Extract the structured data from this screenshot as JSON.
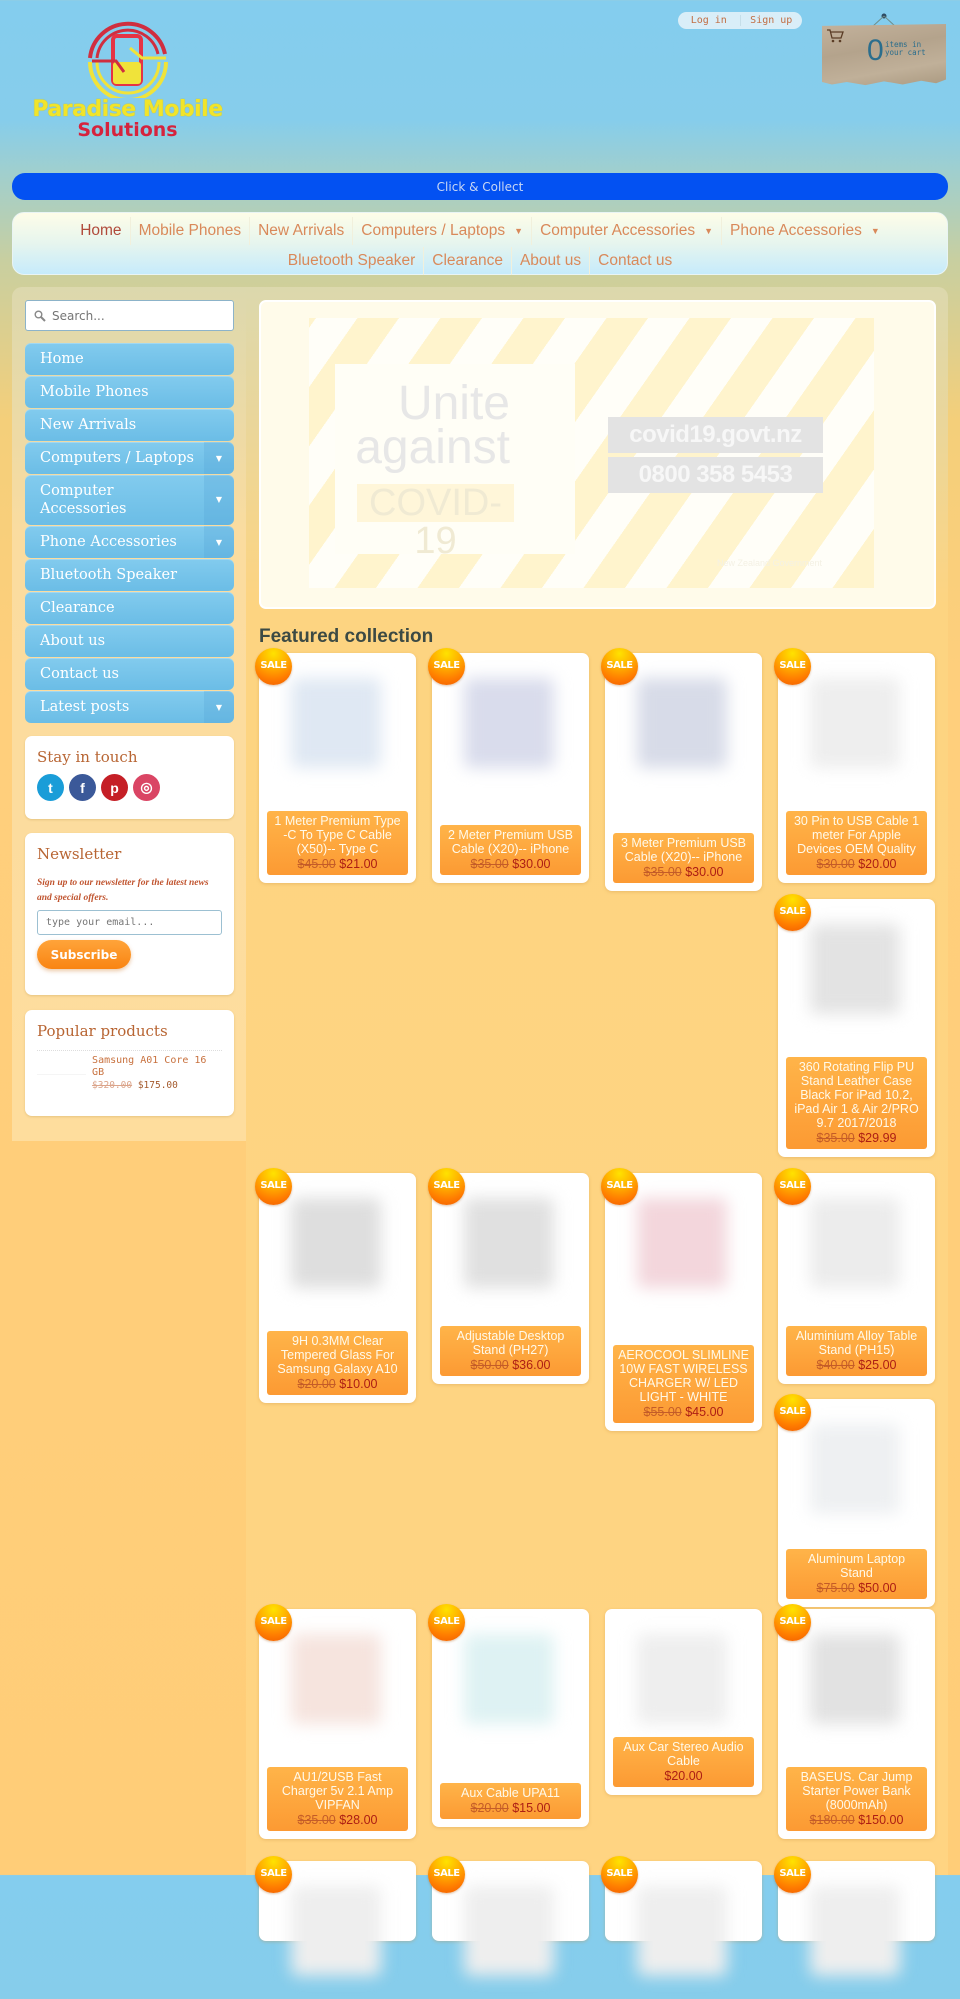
{
  "brand": {
    "line1": "Paradise Mobile",
    "line2": "Solutions",
    "colors": {
      "yellow": "#f1e42a",
      "red": "#d6233d"
    }
  },
  "auth": {
    "login": "Log in",
    "signup": "Sign up"
  },
  "cart": {
    "icon": "cart-icon",
    "count": "0",
    "label": "items in your cart"
  },
  "announcement": {
    "text": "Click & Collect",
    "color": "#0351f2"
  },
  "top_nav": {
    "items": [
      {
        "label": "Home",
        "active": true,
        "dropdown": false
      },
      {
        "label": "Mobile Phones",
        "dropdown": false
      },
      {
        "label": "New Arrivals",
        "dropdown": false
      },
      {
        "label": "Computers / Laptops",
        "dropdown": true
      },
      {
        "label": "Computer Accessories",
        "dropdown": true
      },
      {
        "label": "Phone Accessories",
        "dropdown": true
      },
      {
        "label": "Bluetooth Speaker",
        "dropdown": false
      },
      {
        "label": "Clearance",
        "dropdown": false
      },
      {
        "label": "About us",
        "dropdown": false
      },
      {
        "label": "Contact us",
        "dropdown": false
      }
    ],
    "caret": "▼"
  },
  "sidebar": {
    "search": {
      "placeholder": "Search...",
      "icon": "search-icon"
    },
    "menu": [
      {
        "label": "Home",
        "expandable": false
      },
      {
        "label": "Mobile Phones",
        "expandable": false
      },
      {
        "label": "New Arrivals",
        "expandable": false
      },
      {
        "label": "Computers / Laptops",
        "expandable": true
      },
      {
        "label": "Computer Accessories",
        "expandable": true
      },
      {
        "label": "Phone Accessories",
        "expandable": true
      },
      {
        "label": "Bluetooth Speaker",
        "expandable": false
      },
      {
        "label": "Clearance",
        "expandable": false
      },
      {
        "label": "About us",
        "expandable": false
      },
      {
        "label": "Contact us",
        "expandable": false
      },
      {
        "label": "Latest posts",
        "expandable": true
      }
    ],
    "stay_in_touch": {
      "title": "Stay in touch",
      "networks": [
        {
          "name": "twitter",
          "glyph": "t",
          "color": "#1a9dd8"
        },
        {
          "name": "facebook",
          "glyph": "f",
          "color": "#3b5999"
        },
        {
          "name": "pinterest",
          "glyph": "p",
          "color": "#c51f26"
        },
        {
          "name": "instagram",
          "glyph": "◎",
          "color": "#da4564"
        }
      ]
    },
    "newsletter": {
      "title": "Newsletter",
      "description": "Sign up to our newsletter for the latest news and special offers.",
      "placeholder": "type your email...",
      "button": "Subscribe"
    },
    "popular": {
      "title": "Popular products",
      "items": [
        {
          "name": "Samsung A01 Core 16 GB",
          "compare_price": "$320.00",
          "price": "$175.00"
        }
      ]
    }
  },
  "hero": {
    "headline_1": "Unite",
    "headline_2": "against",
    "headline_3": "COVID-19",
    "website": "covid19.govt.nz",
    "phone": "0800 358 5453",
    "footer": "New Zealand Government"
  },
  "featured": {
    "title": "Featured collection",
    "sale_label": "SALE",
    "products": [
      {
        "name": "1 Meter Premium Type -C To Type C Cable (X50)-- Type C",
        "compare_price": "$45.00",
        "price": "$21.00",
        "sale": true
      },
      {
        "name": "2 Meter Premium USB Cable (X20)-- iPhone",
        "compare_price": "$35.00",
        "price": "$30.00",
        "sale": true
      },
      {
        "name": "3 Meter Premium USB Cable (X20)-- iPhone",
        "compare_price": "$35.00",
        "price": "$30.00",
        "sale": true
      },
      {
        "name": "30 Pin to USB Cable 1 meter For Apple Devices OEM Quality",
        "compare_price": "$30.00",
        "price": "$20.00",
        "sale": true
      },
      {
        "name": "360 Rotating Flip PU Stand Leather Case Black For iPad 10.2, iPad Air 1 & Air 2/PRO 9.7 2017/2018",
        "compare_price": "$35.00",
        "price": "$29.99",
        "sale": true
      },
      {
        "name": "9H 0.3MM Clear Tempered Glass For Samsung Galaxy A10",
        "compare_price": "$20.00",
        "price": "$10.00",
        "sale": true
      },
      {
        "name": "Adjustable Desktop Stand (PH27)",
        "compare_price": "$50.00",
        "price": "$36.00",
        "sale": true
      },
      {
        "name": "AEROCOOL SLIMLINE 10W FAST WIRELESS CHARGER W/ LED LIGHT - WHITE",
        "compare_price": "$55.00",
        "price": "$45.00",
        "sale": true
      },
      {
        "name": "Aluminium Alloy Table Stand (PH15)",
        "compare_price": "$40.00",
        "price": "$25.00",
        "sale": true
      },
      {
        "name": "Aluminum Laptop Stand",
        "compare_price": "$75.00",
        "price": "$50.00",
        "sale": true
      },
      {
        "name": "AU1/2USB Fast Charger 5v 2.1 Amp VIPFAN",
        "compare_price": "$35.00",
        "price": "$28.00",
        "sale": true
      },
      {
        "name": "Aux Cable UPA11",
        "compare_price": "$20.00",
        "price": "$15.00",
        "sale": true
      },
      {
        "name": "Aux Car Stereo Audio Cable",
        "compare_price": "",
        "price": "$20.00",
        "sale": false
      },
      {
        "name": "BASEUS. Car Jump Starter Power Bank (8000mAh)",
        "compare_price": "$180.00",
        "price": "$150.00",
        "sale": true
      },
      {
        "name": "",
        "compare_price": "",
        "price": "",
        "sale": true
      },
      {
        "name": "",
        "compare_price": "",
        "price": "",
        "sale": true
      },
      {
        "name": "",
        "compare_price": "",
        "price": "",
        "sale": true
      },
      {
        "name": "",
        "compare_price": "",
        "price": "",
        "sale": true
      }
    ]
  }
}
